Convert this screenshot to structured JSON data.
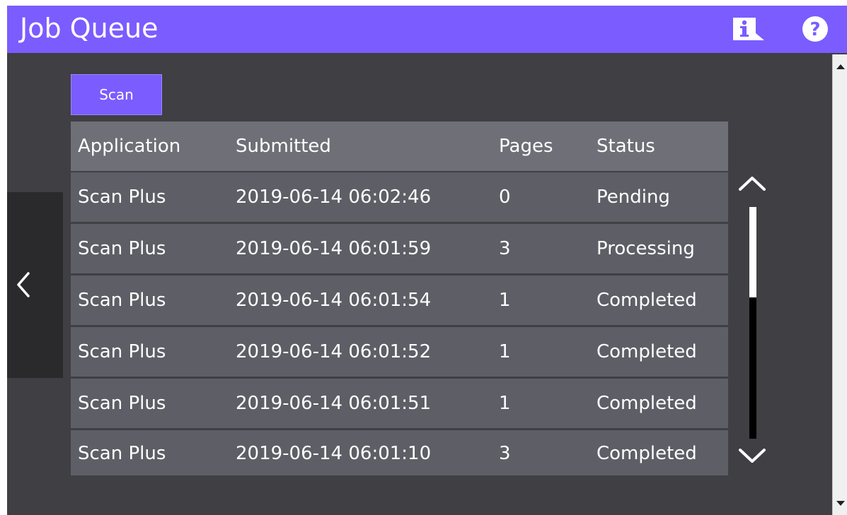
{
  "header": {
    "title": "Job Queue",
    "info_icon": "info-icon",
    "help_icon": "help-icon",
    "help_glyph": "?"
  },
  "colors": {
    "accent": "#7b5cff",
    "background": "#3f3f44",
    "row": "#5e5e66",
    "header_row": "#6f6f77"
  },
  "actions": {
    "scan_label": "Scan"
  },
  "table": {
    "columns": [
      "Application",
      "Submitted",
      "Pages",
      "Status"
    ],
    "rows": [
      {
        "application": "Scan Plus",
        "submitted": "2019-06-14 06:02:46",
        "pages": "0",
        "status": "Pending"
      },
      {
        "application": "Scan Plus",
        "submitted": "2019-06-14 06:01:59",
        "pages": "3",
        "status": "Processing"
      },
      {
        "application": "Scan Plus",
        "submitted": "2019-06-14 06:01:54",
        "pages": "1",
        "status": "Completed"
      },
      {
        "application": "Scan Plus",
        "submitted": "2019-06-14 06:01:52",
        "pages": "1",
        "status": "Completed"
      },
      {
        "application": "Scan Plus",
        "submitted": "2019-06-14 06:01:51",
        "pages": "1",
        "status": "Completed"
      },
      {
        "application": "Scan Plus",
        "submitted": "2019-06-14 06:01:10",
        "pages": "3",
        "status": "Completed"
      }
    ]
  },
  "navigation": {
    "back_icon": "chevron-left-icon"
  },
  "list_scroll": {
    "up_icon": "chevron-up-icon",
    "down_icon": "chevron-down-icon",
    "position_fraction": 0.0,
    "visible_fraction": 0.39
  }
}
